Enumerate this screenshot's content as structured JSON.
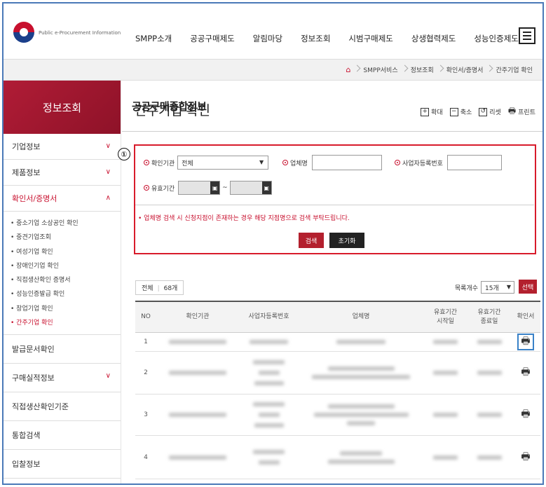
{
  "header": {
    "logo_main": "공공구매종합정보",
    "logo_sub": "Public e-Procurement Information",
    "nav": [
      "SMPP소개",
      "공공구매제도",
      "알림마당",
      "정보조회",
      "시범구매제도",
      "상생협력제도",
      "성능인증제도"
    ]
  },
  "breadcrumb": [
    "SMPP서비스",
    "정보조회",
    "확인서/증명서",
    "간주기업 확인"
  ],
  "sidebar": {
    "title": "정보조회",
    "items_top": [
      "기업정보",
      "제품정보",
      "확인서/증명서"
    ],
    "sub_items": [
      "중소기업 소상공인 확인",
      "중견기업조회",
      "여성기업 확인",
      "장애인기업 확인",
      "직접생산확인 증명서",
      "성능인증발급 확인",
      "창업기업 확인",
      "간주기업 확인"
    ],
    "items_bottom": [
      "발급문서확인",
      "구매실적정보",
      "직접생산확인기준",
      "통합검색",
      "입찰정보"
    ]
  },
  "page": {
    "title": "간주기업 확인",
    "tools": [
      "확대",
      "축소",
      "리셋",
      "프린트"
    ],
    "marker": "①"
  },
  "search": {
    "org_label": "확인기관",
    "org_value": "전체",
    "company_label": "업체명",
    "biz_label": "사업자등록번호",
    "period_label": "유효기간",
    "date_sep": "~",
    "notice": "업체명 검색 시 신청지점이 존재하는 경우 해당 지점명으로 검색 부탁드립니다.",
    "search_btn": "검색",
    "reset_btn": "초기화"
  },
  "list": {
    "total_label": "전체",
    "total_count": "68개",
    "per_page_label": "목록개수",
    "per_page_value": "15개",
    "select_btn": "선택"
  },
  "table": {
    "headers": [
      "NO",
      "확인기관",
      "사업자등록번호",
      "업체명",
      "유효기간 시작일",
      "유효기간 종료일",
      "확인서"
    ],
    "rows": [
      {
        "no": "1"
      },
      {
        "no": "2"
      },
      {
        "no": "3"
      },
      {
        "no": "4"
      }
    ]
  },
  "colors": {
    "accent": "#c8102e",
    "highlight_border": "#d81b2b",
    "frame_border": "#4a79b8"
  }
}
